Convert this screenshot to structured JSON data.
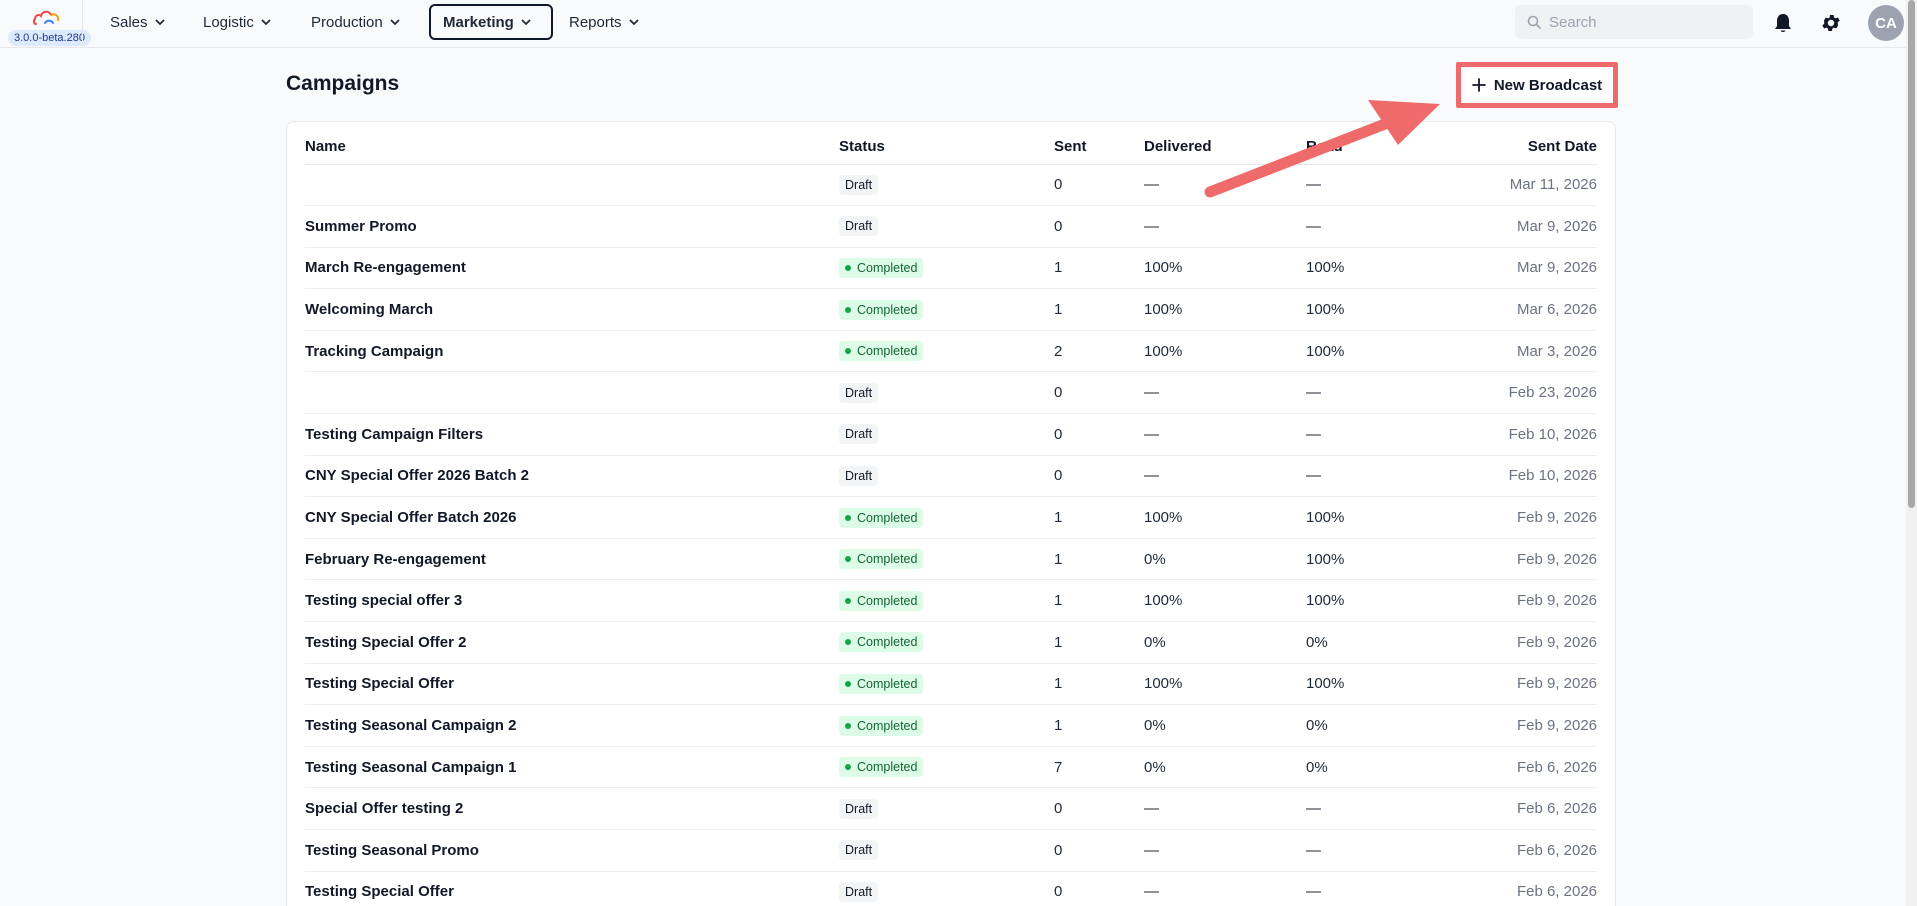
{
  "app": {
    "version": "3.0.0-beta.280"
  },
  "nav": [
    {
      "label": "Sales"
    },
    {
      "label": "Logistic"
    },
    {
      "label": "Production"
    },
    {
      "label": "Marketing"
    },
    {
      "label": "Reports"
    }
  ],
  "search": {
    "placeholder": "Search"
  },
  "user": {
    "initials": "CA"
  },
  "page": {
    "title": "Campaigns",
    "new_button_label": "New Broadcast"
  },
  "table": {
    "columns": [
      "Name",
      "Status",
      "Sent",
      "Delivered",
      "Read",
      "Sent Date"
    ],
    "rows": [
      {
        "name": "",
        "status": "Draft",
        "sent": "0",
        "delivered": "—",
        "read": "—",
        "date": "Mar 11, 2026"
      },
      {
        "name": "Summer Promo",
        "status": "Draft",
        "sent": "0",
        "delivered": "—",
        "read": "—",
        "date": "Mar 9, 2026"
      },
      {
        "name": "March Re-engagement",
        "status": "Completed",
        "sent": "1",
        "delivered": "100%",
        "read": "100%",
        "date": "Mar 9, 2026"
      },
      {
        "name": "Welcoming March",
        "status": "Completed",
        "sent": "1",
        "delivered": "100%",
        "read": "100%",
        "date": "Mar 6, 2026"
      },
      {
        "name": "Tracking Campaign",
        "status": "Completed",
        "sent": "2",
        "delivered": "100%",
        "read": "100%",
        "date": "Mar 3, 2026"
      },
      {
        "name": "",
        "status": "Draft",
        "sent": "0",
        "delivered": "—",
        "read": "—",
        "date": "Feb 23, 2026"
      },
      {
        "name": "Testing Campaign Filters",
        "status": "Draft",
        "sent": "0",
        "delivered": "—",
        "read": "—",
        "date": "Feb 10, 2026"
      },
      {
        "name": "CNY Special Offer 2026 Batch 2",
        "status": "Draft",
        "sent": "0",
        "delivered": "—",
        "read": "—",
        "date": "Feb 10, 2026"
      },
      {
        "name": "CNY Special Offer Batch 2026",
        "status": "Completed",
        "sent": "1",
        "delivered": "100%",
        "read": "100%",
        "date": "Feb 9, 2026"
      },
      {
        "name": "February Re-engagement",
        "status": "Completed",
        "sent": "1",
        "delivered": "0%",
        "read": "100%",
        "date": "Feb 9, 2026"
      },
      {
        "name": "Testing special offer 3",
        "status": "Completed",
        "sent": "1",
        "delivered": "100%",
        "read": "100%",
        "date": "Feb 9, 2026"
      },
      {
        "name": "Testing Special Offer 2",
        "status": "Completed",
        "sent": "1",
        "delivered": "0%",
        "read": "0%",
        "date": "Feb 9, 2026"
      },
      {
        "name": "Testing Special Offer",
        "status": "Completed",
        "sent": "1",
        "delivered": "100%",
        "read": "100%",
        "date": "Feb 9, 2026"
      },
      {
        "name": "Testing Seasonal Campaign 2",
        "status": "Completed",
        "sent": "1",
        "delivered": "0%",
        "read": "0%",
        "date": "Feb 9, 2026"
      },
      {
        "name": "Testing Seasonal Campaign 1",
        "status": "Completed",
        "sent": "7",
        "delivered": "0%",
        "read": "0%",
        "date": "Feb 6, 2026"
      },
      {
        "name": "Special Offer testing 2",
        "status": "Draft",
        "sent": "0",
        "delivered": "—",
        "read": "—",
        "date": "Feb 6, 2026"
      },
      {
        "name": "Testing Seasonal Promo",
        "status": "Draft",
        "sent": "0",
        "delivered": "—",
        "read": "—",
        "date": "Feb 6, 2026"
      },
      {
        "name": "Testing Special Offer",
        "status": "Draft",
        "sent": "0",
        "delivered": "—",
        "read": "—",
        "date": "Feb 6, 2026"
      }
    ]
  },
  "colors": {
    "annotation": "#ef6b6b",
    "completed_bg": "#dcfce7",
    "completed_text": "#166534",
    "draft_bg": "#f3f4f6"
  },
  "icons": [
    "cloud-logo-icon",
    "chevron-down-icon",
    "search-icon",
    "bell-icon",
    "gear-icon",
    "plus-icon",
    "annotation-arrow-icon"
  ]
}
